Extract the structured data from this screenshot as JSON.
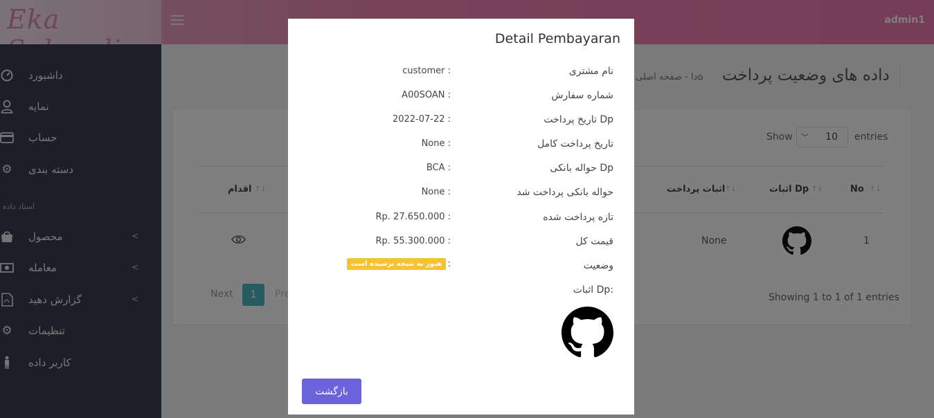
{
  "header": {
    "logo_text": "Eka Suhandi",
    "user": "admin1"
  },
  "sidebar": {
    "items": [
      {
        "label": "داشبورد",
        "icon": "dashboard-icon"
      },
      {
        "label": "نمایه",
        "icon": "user-icon"
      },
      {
        "label": "حساب",
        "icon": "credit-card-icon"
      },
      {
        "label": "دسته بندی",
        "icon": "gear-icon"
      },
      {
        "label": "محصول",
        "icon": "shopping-bag-icon"
      },
      {
        "label": "معامله",
        "icon": "money-icon"
      },
      {
        "label": "گزارش دهید",
        "icon": "file-pdf-icon"
      },
      {
        "label": "تنظیمات",
        "icon": "cogs-icon"
      },
      {
        "label": "کاربر داده",
        "icon": "person-icon"
      }
    ],
    "section_label": "استاد داده"
  },
  "main": {
    "title": "داده های وضعیت پرداخت",
    "breadcrumb_home": "صفحه اصلی",
    "breadcrumb_sep": "-",
    "breadcrumb_current": "دا",
    "show_label": "Show",
    "entries_value": "10",
    "entries_label": "entries",
    "table_headers": {
      "no": "No",
      "dp_proof": "اثبات Dp",
      "payment_proof": "اثبات پرداخت",
      "action": "اقدام"
    },
    "row": {
      "no": "1",
      "payment_proof": "None"
    },
    "showing": "Showing 1 to 1 of 1 entries",
    "pagination": {
      "next": "Next",
      "current": "1",
      "prev": "Pre"
    }
  },
  "modal": {
    "title": "Detail Pembayaran",
    "rows": [
      {
        "label": "نام مشتری",
        "value": "customer :"
      },
      {
        "label": "شماره سفارش",
        "value": "A00SOAN :"
      },
      {
        "label": "تاریخ پرداخت Dp",
        "value": "2022-07-22 :"
      },
      {
        "label": "تاریخ پرداخت کامل",
        "value": "None :"
      },
      {
        "label": "حواله بانکی Dp",
        "value": "BCA :"
      },
      {
        "label": "حواله بانکی پرداخت شد",
        "value": "None :"
      },
      {
        "label": "تازه پرداخت شده",
        "value": "Rp. 27.650.000 :"
      },
      {
        "label": "قیمت کل",
        "value": "Rp. 55.300.000 :"
      },
      {
        "label": "وضعیت",
        "value": ":"
      }
    ],
    "status_badge": "هنوز به نتیجه نرسیده است",
    "status_color": "#f6c232",
    "proof_label": "اثبات Dp:",
    "back_button": "بازگشت",
    "button_color": "#6b63db"
  }
}
